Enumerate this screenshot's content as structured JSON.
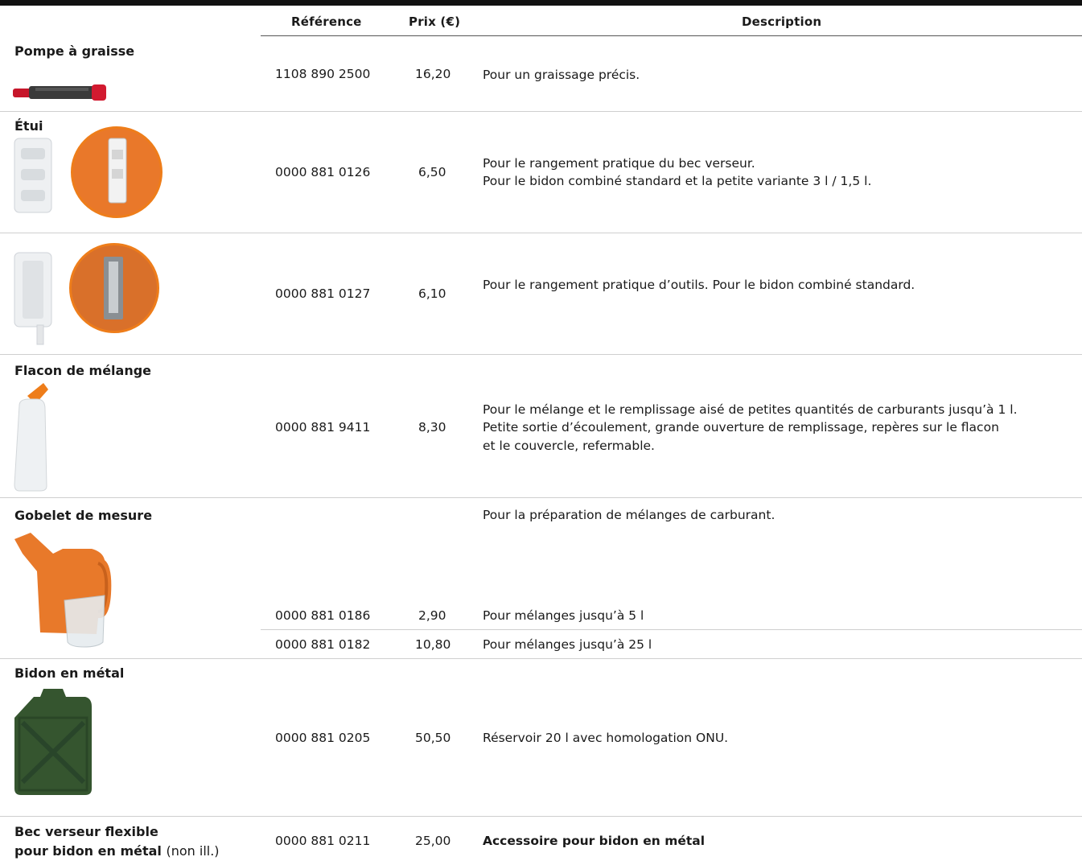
{
  "table": {
    "headers": {
      "reference": "Référence",
      "price": "Prix (€)",
      "description": "Description"
    },
    "rows": [
      {
        "name": "Pompe à graisse",
        "ref": "1108 890 2500",
        "price": "16,20",
        "desc": [
          "Pour un graissage précis."
        ]
      },
      {
        "name": "Étui",
        "ref": "0000 881 0126",
        "price": "6,50",
        "desc": [
          "Pour le rangement pratique du bec verseur.",
          "Pour le bidon combiné standard et la petite variante 3 l / 1,5 l."
        ]
      },
      {
        "name": "",
        "ref": "0000 881 0127",
        "price": "6,10",
        "desc": [
          "Pour le rangement pratique d’outils. Pour le bidon combiné standard."
        ]
      },
      {
        "name": "Flacon de mélange",
        "ref": "0000 881 9411",
        "price": "8,30",
        "desc": [
          "Pour le mélange et le remplissage aisé de petites quantités de carburants jusqu’à 1 l.",
          "Petite sortie d’écoulement, grande ouverture de remplissage, repères sur le flacon",
          "et le couvercle, refermable."
        ]
      },
      {
        "name": "Gobelet de mesure",
        "intro": "Pour la préparation de mélanges de carburant.",
        "variants": [
          {
            "ref": "0000 881 0186",
            "price": "2,90",
            "desc": "Pour mélanges jusqu’à 5 l"
          },
          {
            "ref": "0000 881 0182",
            "price": "10,80",
            "desc": "Pour mélanges jusqu’à 25 l"
          }
        ]
      },
      {
        "name": "Bidon en métal",
        "ref": "0000 881 0205",
        "price": "50,50",
        "desc": [
          "Réservoir 20 l avec homologation ONU."
        ]
      },
      {
        "name_line1": "Bec verseur flexible",
        "name_line2": "pour bidon en métal",
        "name_note": "(non ill.)",
        "ref": "0000 881 0211",
        "price": "25,00",
        "desc": [
          "Accessoire pour bidon en métal"
        ]
      }
    ]
  },
  "colors": {
    "accent": "#ee7d1a",
    "rule": "#cfcfcf",
    "text": "#1a1a1a"
  },
  "icons": [
    "grease-pump-image",
    "holder-image",
    "tool-holder-image",
    "mixing-bottle-image",
    "measuring-jug-image",
    "metal-canister-image"
  ]
}
